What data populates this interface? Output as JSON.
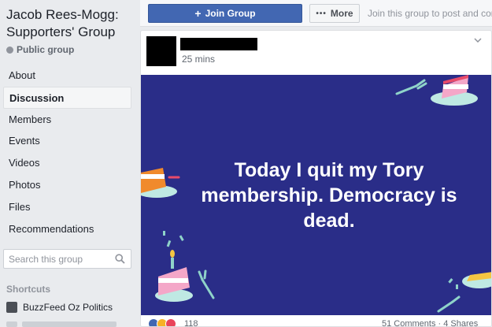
{
  "group": {
    "name": "Jacob Rees-Mogg: Supporters' Group",
    "privacy": "Public group"
  },
  "nav": {
    "items": [
      "About",
      "Discussion",
      "Members",
      "Events",
      "Videos",
      "Photos",
      "Files",
      "Recommendations"
    ],
    "active": "Discussion"
  },
  "search": {
    "placeholder": "Search this group"
  },
  "shortcuts": {
    "title": "Shortcuts",
    "items": [
      "BuzzFeed Oz Politics"
    ]
  },
  "topbar": {
    "join_label": "Join Group",
    "more_label": "More",
    "join_hint": "Join this group to post and comm"
  },
  "post": {
    "time": "25 mins",
    "text": "Today I quit my Tory membership. Democracy is dead.",
    "background_color": "#2a2d88",
    "reaction_count": "118",
    "comments": "51 Comments",
    "shares": "4 Shares",
    "comments_shares": "51 Comments · 4 Shares"
  },
  "colors": {
    "primary": "#4267b2",
    "sidebar_bg": "#e9ebee"
  },
  "icons": [
    "globe-icon",
    "search-icon",
    "plus-icon",
    "dots-icon",
    "chevron-down-icon",
    "like-icon",
    "haha-icon",
    "love-icon"
  ]
}
